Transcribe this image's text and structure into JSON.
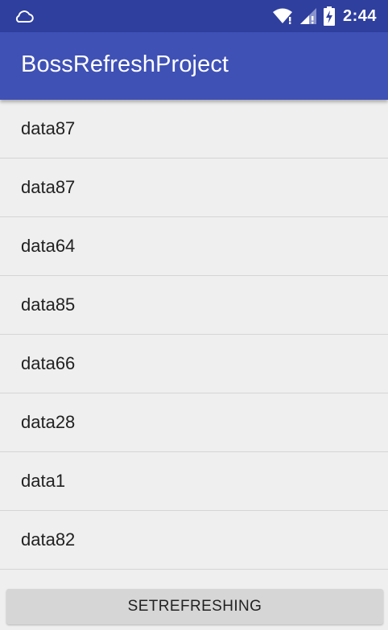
{
  "status_bar": {
    "time": "2:44",
    "icons": [
      "cloud-icon",
      "wifi-icon",
      "signal-icon",
      "battery-charging-icon"
    ]
  },
  "app_bar": {
    "title": "BossRefreshProject"
  },
  "list": {
    "items": [
      {
        "label": "data87"
      },
      {
        "label": "data87"
      },
      {
        "label": "data64"
      },
      {
        "label": "data85"
      },
      {
        "label": "data66"
      },
      {
        "label": "data28"
      },
      {
        "label": "data1"
      },
      {
        "label": "data82"
      }
    ]
  },
  "bottom": {
    "button_label": "SETREFRESHING"
  },
  "colors": {
    "status_bar": "#2f3f9e",
    "app_bar": "#3f51b5",
    "background": "#efefef"
  }
}
